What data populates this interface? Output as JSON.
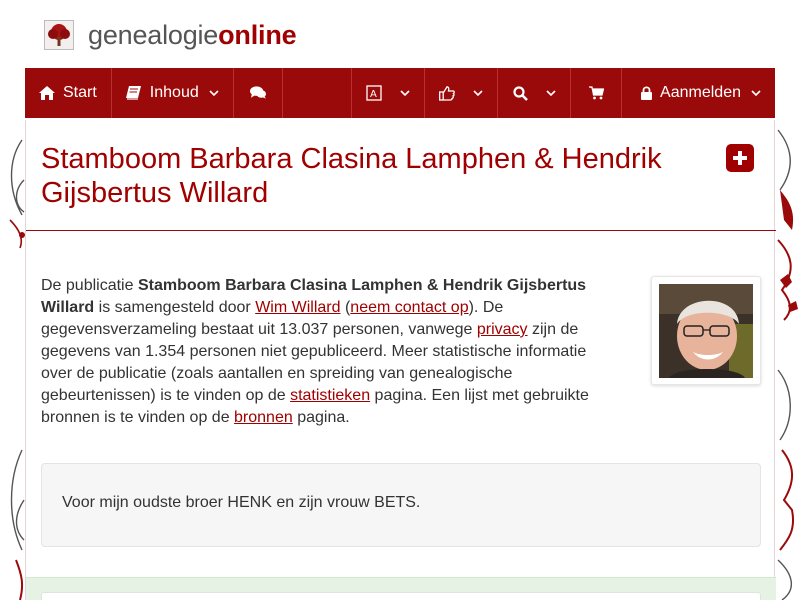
{
  "logo": {
    "text_regular": "genealogie",
    "text_bold": "online",
    "icon": "tree-icon"
  },
  "nav": {
    "start": "Start",
    "inhoud": "Inhoud",
    "aanmelden": "Aanmelden",
    "icons": [
      "home-icon",
      "book-icon",
      "comments-icon",
      "translate-icon",
      "thumbs-up-icon",
      "search-icon",
      "cart-icon",
      "lock-icon"
    ]
  },
  "page": {
    "title": "Stamboom Barbara Clasina Lamphen & Hendrik Gijsbertus Willard"
  },
  "intro": {
    "t1": "De publicatie ",
    "pub_name": "Stamboom Barbara Clasina Lamphen & Hendrik Gijsbertus Willard",
    "t2": " is samengesteld door ",
    "author": "Wim Willard",
    "t3": " (",
    "contact": "neem contact op",
    "t4": "). De gegevensverzameling bestaat uit 13.037 personen, vanwege ",
    "privacy": "privacy",
    "t5": " zijn de gegevens van 1.354 personen niet gepubliceerd. Meer statistische informatie over de publicatie (zoals aantallen en spreiding van genealogische gebeurtenissen) is te vinden op de ",
    "stats": "statistieken",
    "t6": " pagina. Een lijst met gebruikte bronnen is te vinden op de ",
    "sources": "bronnen",
    "t7": " pagina."
  },
  "dedication": "Voor mijn oudste broer HENK en zijn vrouw BETS.",
  "colors": {
    "brand": "#9b0a0a",
    "title": "#a00000",
    "accent_green": "#e6f3e4"
  }
}
